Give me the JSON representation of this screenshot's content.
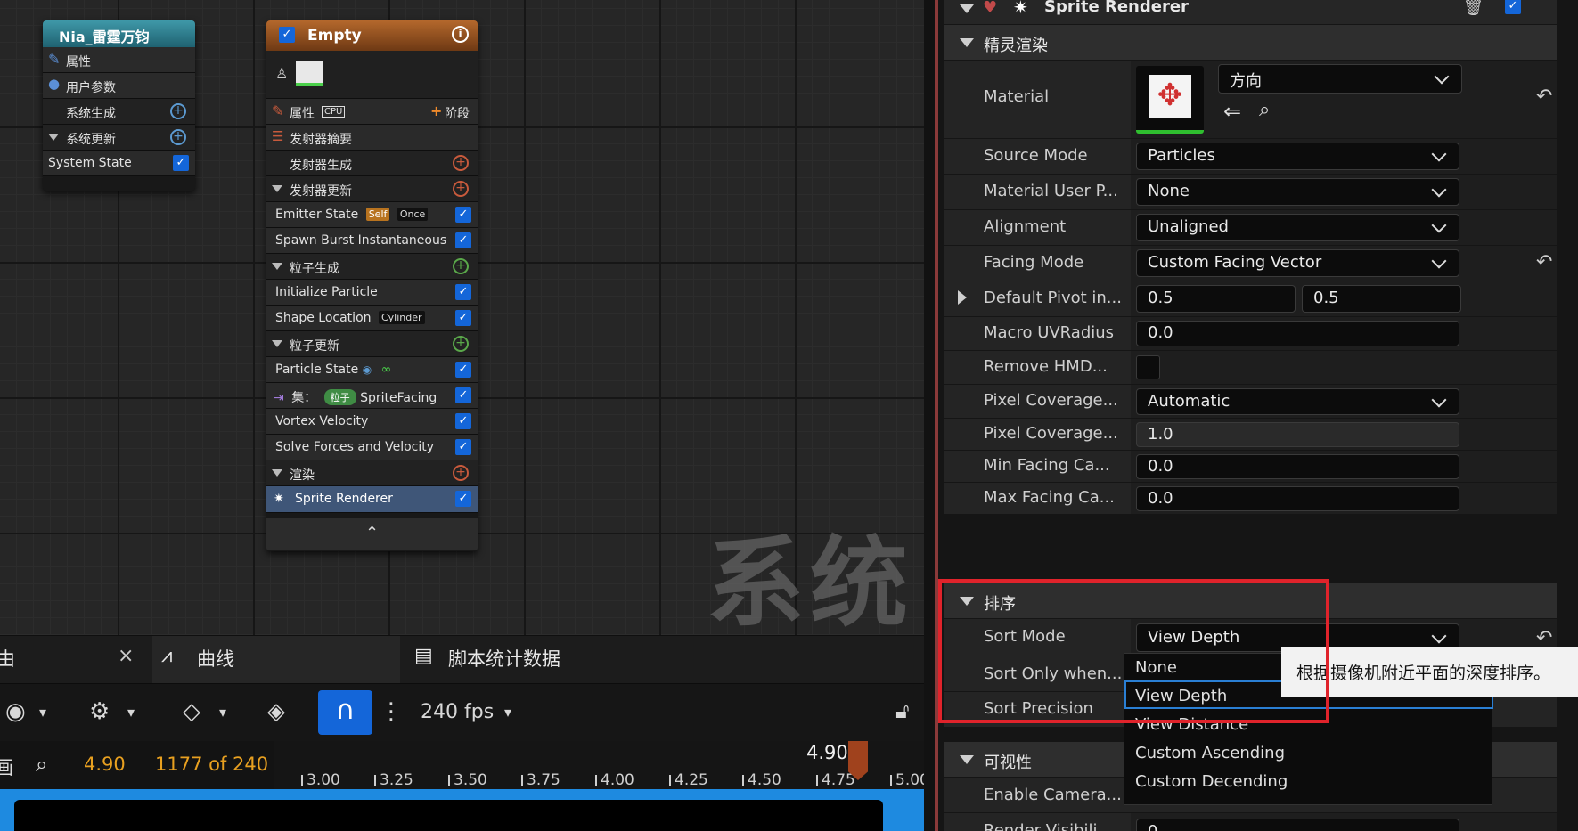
{
  "graph": {
    "watermark": "系统",
    "system_node": {
      "title": "Nia_雷霆万钧",
      "rows": {
        "properties": "属性",
        "user_params": "用户参数",
        "system_spawn": "系统生成",
        "system_update": "系统更新",
        "system_state": "System State"
      }
    },
    "emitter_node": {
      "title": "Empty",
      "info_icon": "i",
      "properties": "属性",
      "cpu_badge": "CPU",
      "stage_label": "阶段",
      "emitter_summary": "发射器摘要",
      "emitter_spawn": "发射器生成",
      "emitter_update": "发射器更新",
      "emitter_state": "Emitter State",
      "self_badge": "Self",
      "once_badge": "Once",
      "spawn_burst": "Spawn Burst Instantaneous",
      "particle_spawn": "粒子生成",
      "initialize_particle": "Initialize Particle",
      "shape_location": "Shape Location",
      "cylinder_badge": "Cylinder",
      "particle_update": "粒子更新",
      "particle_state": "Particle State",
      "set_label": "集：",
      "particle_pill": "粒子",
      "sprite_facing": "SpriteFacing",
      "vortex_velocity": "Vortex Velocity",
      "solve_forces": "Solve Forces and Velocity",
      "render": "渲染",
      "sprite_renderer": "Sprite Renderer",
      "collapse": "⌃"
    }
  },
  "bottom": {
    "tabs": {
      "partial": "由",
      "close": "×",
      "curves": "曲线",
      "script_stats": "脚本统计数据"
    },
    "toolbar": {
      "fps": "240 fps"
    },
    "timeline": {
      "partial_left": "画",
      "current_time": "4.90",
      "frame_count": "1177 of 240(",
      "playhead_label": "4.90",
      "ticks": [
        "3.00",
        "3.25",
        "3.50",
        "3.75",
        "4.00",
        "4.25",
        "4.50",
        "4.75",
        "5.00"
      ]
    }
  },
  "details": {
    "component_title": "Sprite Renderer",
    "section_sprite": "精灵渲染",
    "material": {
      "label": "Material",
      "value": "方向"
    },
    "source_mode": {
      "label": "Source Mode",
      "value": "Particles"
    },
    "material_user_param": {
      "label": "Material User P...",
      "value": "None"
    },
    "alignment": {
      "label": "Alignment",
      "value": "Unaligned"
    },
    "facing_mode": {
      "label": "Facing Mode",
      "value": "Custom Facing Vector"
    },
    "default_pivot": {
      "label": "Default Pivot in...",
      "x": "0.5",
      "y": "0.5"
    },
    "macro_uv": {
      "label": "Macro UVRadius",
      "value": "0.0"
    },
    "remove_hmd": {
      "label": "Remove HMD..."
    },
    "pixel_coverage_mode": {
      "label": "Pixel Coverage...",
      "value": "Automatic"
    },
    "pixel_coverage_blend": {
      "label": "Pixel Coverage...",
      "value": "1.0"
    },
    "min_facing": {
      "label": "Min Facing Ca...",
      "value": "0.0"
    },
    "max_facing": {
      "label": "Max Facing Ca...",
      "value": "0.0"
    },
    "section_sort": "排序",
    "sort": {
      "sort_mode": {
        "label": "Sort Mode",
        "value": "View Depth"
      },
      "sort_only_when": {
        "label": "Sort Only when..."
      },
      "sort_precision": {
        "label": "Sort Precision"
      }
    },
    "section_visibility": "可视性",
    "enable_camera": {
      "label": "Enable Camera..."
    },
    "partial_row": {
      "label": "Render Visibili...",
      "value": "0"
    }
  },
  "dropdown": {
    "options": [
      "None",
      "View Depth",
      "View Distance",
      "Custom Ascending",
      "Custom Decending"
    ],
    "selected": "View Depth",
    "tooltip": "根据摄像机附近平面的深度排序。"
  },
  "colors": {
    "accent": "#1466d9",
    "highlight_box": "#e0232b",
    "system_header": "#2b7c8c",
    "emitter_header": "#a35a26"
  }
}
